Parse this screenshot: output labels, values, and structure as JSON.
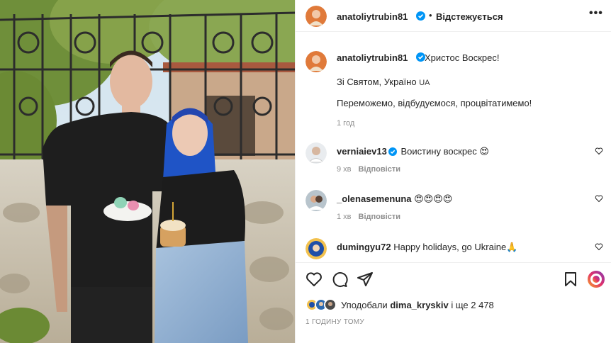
{
  "post": {
    "author": "anatoliytrubin81",
    "follow_status": "Відстежується",
    "more_label": "•••"
  },
  "caption": {
    "author": "anatoliytrubin81",
    "line1": "Христос Воскрес!",
    "line2": "Зі Святом, Україно",
    "line2_flag": "UA",
    "line3": "Переможемо, відбудуємося, процвітатимемо!",
    "time": "1 год"
  },
  "comments": [
    {
      "user": "verniaiev13",
      "verified": true,
      "text": "Воистину воскрес 😍",
      "time": "9 хв",
      "reply": "Відповісти"
    },
    {
      "user": "_olenasemenuna",
      "verified": false,
      "text": "😍😍😍😍",
      "time": "1 хв",
      "reply": "Відповісти"
    },
    {
      "user": "dumingyu72",
      "verified": false,
      "text": "Happy holidays, go Ukraine🙏",
      "time": "",
      "reply": ""
    }
  ],
  "likes": {
    "prefix": "Уподобали",
    "user": "dima_kryskiv",
    "suffix": "і ще 2 478"
  },
  "posted_ago": "1 ГОДИНУ ТОМУ",
  "colors": {
    "verified": "#0095f6",
    "muted": "#8e8e8e",
    "text": "#262626"
  }
}
